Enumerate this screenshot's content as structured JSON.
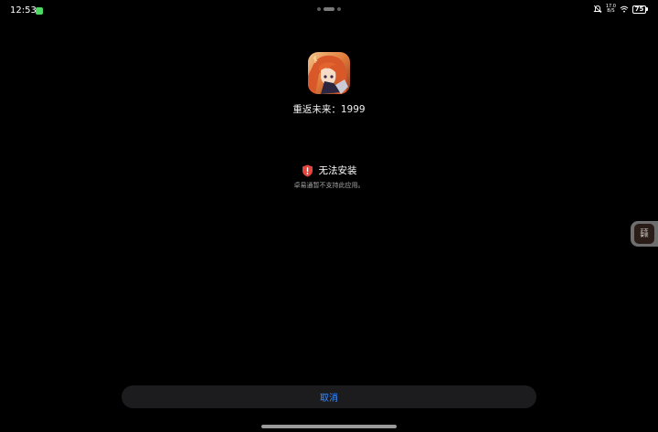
{
  "status_bar": {
    "time": "12:53",
    "net_speed_value": "17.0",
    "net_speed_unit": "B/S",
    "battery_level": "75"
  },
  "app": {
    "name": "重返未来：1999"
  },
  "warning": {
    "title": "无法安装",
    "description": "卓易通暂不支持此应用。"
  },
  "side_float": {
    "line1": "正在",
    "line2": "安装"
  },
  "actions": {
    "cancel_label": "取消"
  },
  "colors": {
    "background": "#000000",
    "warning_icon": "#e5453c",
    "cancel_text": "#3d8bff",
    "button_bg": "#1c1c1e"
  }
}
